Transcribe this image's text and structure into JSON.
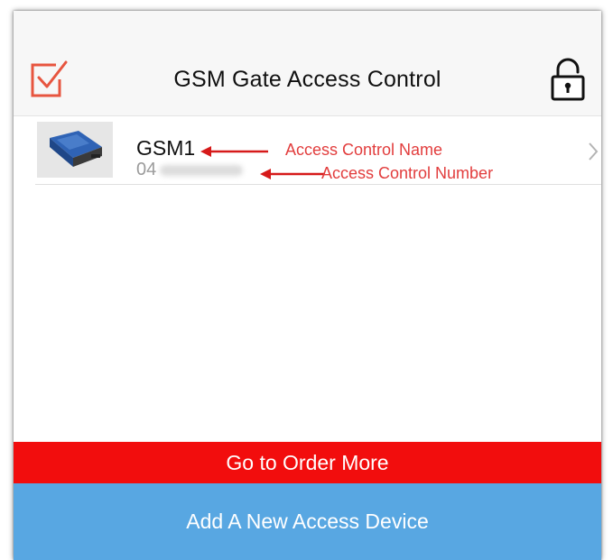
{
  "header": {
    "title": "GSM Gate Access Control",
    "left_icon": "checkbox-icon",
    "right_icon": "unlock-icon"
  },
  "devices": [
    {
      "name": "GSM1",
      "number_visible_prefix": "04",
      "thumbnail_icon": "gsm-device-icon",
      "chevron_icon": "chevron-right-icon"
    }
  ],
  "annotations": {
    "name_label": "Access Control Name",
    "number_label": "Access Control Number"
  },
  "actions": {
    "order_label": "Go to Order More",
    "add_label": "Add A New Access Device"
  },
  "colors": {
    "accent_red": "#f20d0d",
    "accent_blue": "#58a7e2",
    "check_icon": "#e7553f",
    "annotation": "#e23d3d"
  }
}
